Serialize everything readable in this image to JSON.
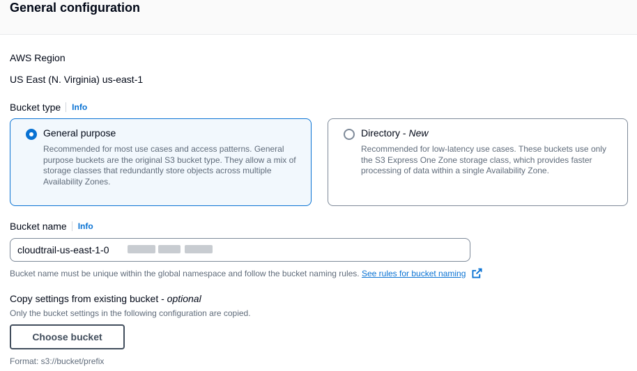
{
  "header": {
    "title": "General configuration"
  },
  "region": {
    "label": "AWS Region",
    "value": "US East (N. Virginia) us-east-1"
  },
  "bucket_type": {
    "label": "Bucket type",
    "info": "Info",
    "options": [
      {
        "title": "General purpose",
        "badge": "",
        "description": "Recommended for most use cases and access patterns. General purpose buckets are the original S3 bucket type. They allow a mix of storage classes that redundantly store objects across multiple Availability Zones.",
        "selected": true
      },
      {
        "title": "Directory - ",
        "badge": "New",
        "description": "Recommended for low-latency use cases. These buckets use only the S3 Express One Zone storage class, which provides faster processing of data within a single Availability Zone.",
        "selected": false
      }
    ]
  },
  "bucket_name": {
    "label": "Bucket name",
    "info": "Info",
    "value": "cloudtrail-us-east-1-0",
    "help": "Bucket name must be unique within the global namespace and follow the bucket naming rules.",
    "link": "See rules for bucket naming"
  },
  "copy_settings": {
    "label": "Copy settings from existing bucket - ",
    "optional": "optional",
    "description": "Only the bucket settings in the following configuration are copied.",
    "button": "Choose bucket",
    "format": "Format: s3://bucket/prefix"
  },
  "colors": {
    "accent": "#0972d3",
    "text": "#000716",
    "muted": "#5f6b7a"
  }
}
